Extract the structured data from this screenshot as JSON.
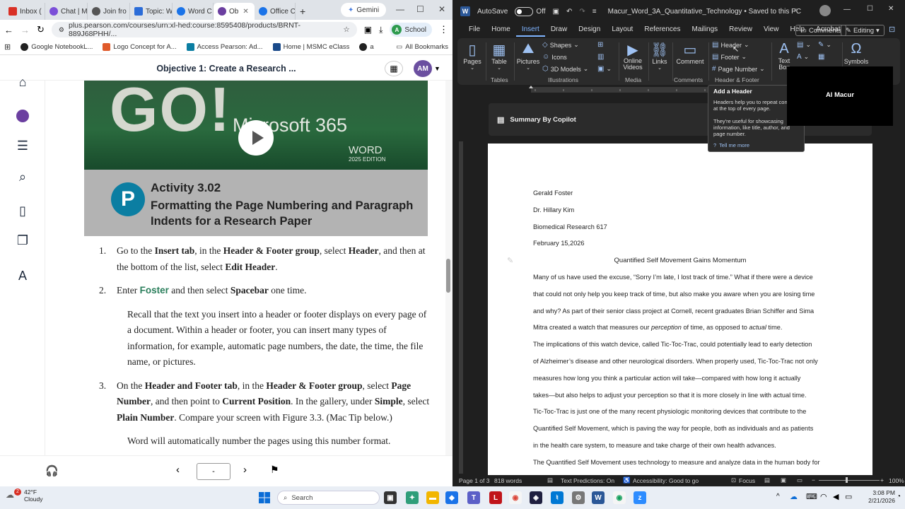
{
  "browser": {
    "tabs": [
      {
        "label": "Inbox (",
        "color": "#d93025"
      },
      {
        "label": "Chat | M",
        "color": "#7b4fd8"
      },
      {
        "label": "Join fro",
        "color": "#555555"
      },
      {
        "label": "Topic: W",
        "color": "#2b6cd8"
      },
      {
        "label": "Word C",
        "color": "#1a73e8"
      },
      {
        "label": "Ob",
        "color": "#6b3fa0"
      },
      {
        "label": "Office C",
        "color": "#1a73e8"
      }
    ],
    "gemini_tab": "Gemini",
    "url": "plus.pearson.com/courses/urn:xl-hed:course:8595408/products/BRNT-889J68PHH/...",
    "school_label": "School",
    "school_badge": "A",
    "bookmarks": [
      {
        "label": "Google NotebookL...",
        "color": "#222222"
      },
      {
        "label": "Logo Concept for A...",
        "color": "#e05a2a"
      },
      {
        "label": "Access Pearson: Ad...",
        "color": "#0b7ea2"
      },
      {
        "label": "Home | MSMC eClass",
        "color": "#1a4a8a"
      },
      {
        "label": "a",
        "color": "#222222"
      }
    ],
    "all_bookmarks": "All Bookmarks"
  },
  "reader": {
    "title": "Objective 1: Create a Research ...",
    "avatar_initials": "AM",
    "cover": {
      "go": "GO!",
      "ms365": "Microsoft 365",
      "word": "WORD",
      "edition": "2025 EDITION",
      "logo_letter": "P",
      "activity": "Activity 3.02",
      "activity_title": "Formatting the Page Numbering and Paragraph Indents for a Research Paper"
    },
    "steps": {
      "s1_num": "1.",
      "s1_a": "Go to the ",
      "s1_b": "Insert tab",
      "s1_c": ", in the ",
      "s1_d": "Header & Footer group",
      "s1_e": ", select ",
      "s1_f": "Header",
      "s1_g": ", and then at the bottom of the list, select ",
      "s1_h": "Edit Header",
      "s1_i": ".",
      "s2_num": "2.",
      "s2_a": "Enter ",
      "s2_b": "Foster",
      "s2_c": " and then select ",
      "s2_d": "Spacebar",
      "s2_e": " one time.",
      "note1": "Recall that the text you insert into a header or footer displays on every page of a document. Within a header or footer, you can insert many types of information, for example, automatic page numbers, the date, the time, the file name, or pictures.",
      "s3_num": "3.",
      "s3_a": "On the ",
      "s3_b": "Header and Footer tab",
      "s3_c": ", in the ",
      "s3_d": "Header & Footer group",
      "s3_e": ", select ",
      "s3_f": "Page Number",
      "s3_g": ", and then point to ",
      "s3_h": "Current Position",
      "s3_i": ". In the gallery, under ",
      "s3_j": "Simple",
      "s3_k": ", select ",
      "s3_l": "Plain Number",
      "s3_m": ". Compare your screen with Figure 3.3. (Mac Tip below.)",
      "note2": "Word will automatically number the pages using this number format."
    },
    "page_input": "-"
  },
  "word": {
    "autosave": "AutoSave",
    "autosave_state": "Off",
    "doc_title": "Macur_Word_3A_Quantitative_Technology • Saved to this PC",
    "menu": [
      "File",
      "Home",
      "Insert",
      "Draw",
      "Design",
      "Layout",
      "References",
      "Mailings",
      "Review",
      "View",
      "Help",
      "Acrobat"
    ],
    "active_menu": "Insert",
    "comments": "Comments",
    "editing": "Editing",
    "ribbon": {
      "pages": "Pages",
      "table": "Table",
      "pictures": "Pictures",
      "shapes": "Shapes",
      "icons": "Icons",
      "models3d": "3D Models",
      "online_videos": "Online Videos",
      "links": "Links",
      "comment": "Comment",
      "header": "Header",
      "footer": "Footer",
      "page_number": "Page Number",
      "text_box": "Text Box",
      "symbols": "Symbols",
      "groups": [
        "Tables",
        "Illustrations",
        "Media",
        "Comments",
        "Header & Footer"
      ]
    },
    "copilot": "Summary By Copilot",
    "tooltip": {
      "title": "Add a Header",
      "p1": "Headers help you to repeat content at the top of every page.",
      "p2": "They're useful for showcasing information, like title, author, and page number.",
      "link": "Tell me more"
    },
    "overlay_name": "Al Macur",
    "doc_lines": {
      "l1": "Gerald Foster",
      "l2": "Dr. Hillary Kim",
      "l3": "Biomedical Research 617",
      "l4": "February 15,2026",
      "title": "Quantified Self Movement Gains Momentum",
      "p1": "Many of us have used the excuse, “Sorry I’m late, I lost track of time.” What if there were a device",
      "p2": "that could not only help you keep track of time, but also make you aware when you are losing time",
      "p3": "and why? As part of their senior class project at Cornell, recent graduates Brian Schiffer and Sima",
      "p4a": "Mitra created a watch that measures our ",
      "p4b": "perception",
      "p4c": " of time, as opposed to ",
      "p4d": "actual",
      "p4e": " time.",
      "p5": "The implications of this watch device, called Tic-Toc-Trac, could potentially lead to early detection",
      "p6": "of Alzheimer’s disease and other neurological disorders. When properly used, Tic-Toc-Trac not only",
      "p7": "measures how long you think a particular action will take—compared with how long it actually",
      "p8": "takes—but also helps to adjust your perception so that it is more closely in line with actual time.",
      "p9": "Tic-Toc-Trac is just one of the many recent physiologic monitoring devices that contribute to the",
      "p10": "Quantified Self Movement, which is paving the way for people, both as individuals and as patients",
      "p11": "in the health care system, to measure and take charge of their own health advances.",
      "p12": "The Quantified Self Movement uses technology to measure and analyze data in the human body for"
    },
    "status": {
      "page": "Page 1 of 3",
      "words": "818 words",
      "predictions": "Text Predictions: On",
      "accessibility": "Accessibility: Good to go",
      "focus": "Focus",
      "zoom": "100%"
    }
  },
  "taskbar": {
    "temp": "42°F",
    "weather": "Cloudy",
    "notif": "2",
    "search": "Search",
    "time": "3:08 PM",
    "date": "2/21/2026"
  }
}
